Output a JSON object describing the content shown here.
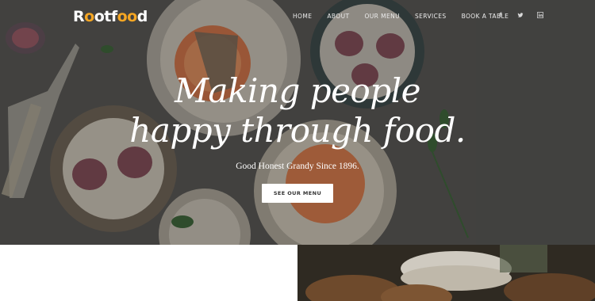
{
  "brand": {
    "logo_prefix": "R",
    "logo_accent1": "o",
    "logo_mid": "otf",
    "logo_accent2": "oo",
    "logo_suffix": "d",
    "accent_color": "#f5a623"
  },
  "nav": {
    "items": [
      {
        "label": "HOME"
      },
      {
        "label": "ABOUT"
      },
      {
        "label": "OUR MENU"
      },
      {
        "label": "SERVICES"
      },
      {
        "label": "BOOK A TABLE"
      }
    ],
    "social": [
      {
        "icon": "facebook-icon",
        "glyph": "f"
      },
      {
        "icon": "twitter-icon",
        "glyph": "t"
      },
      {
        "icon": "linkedin-icon",
        "glyph": "in"
      }
    ]
  },
  "hero": {
    "headline_line1": "Making people",
    "headline_line2": "happy through food.",
    "subheadline": "Good Honest Grandy Since 1896.",
    "cta_label": "SEE OUR MENU"
  }
}
